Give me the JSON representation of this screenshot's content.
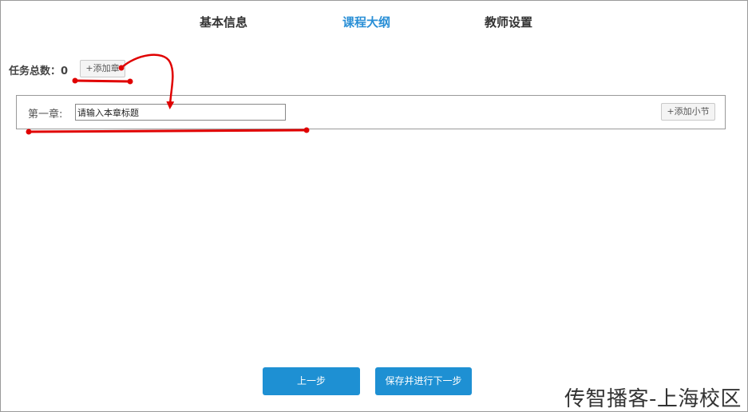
{
  "tabs": [
    {
      "label": "基本信息",
      "active": false
    },
    {
      "label": "课程大纲",
      "active": true
    },
    {
      "label": "教师设置",
      "active": false
    }
  ],
  "toolbar": {
    "total_label": "任务总数：",
    "total_value": "0",
    "add_chapter_label": "+添加章"
  },
  "chapter": {
    "label": "第一章:",
    "title_value": "请输入本章标题",
    "add_section_label": "+添加小节"
  },
  "footer": {
    "prev_label": "上一步",
    "save_next_label": "保存并进行下一步"
  },
  "watermark": "传智播客-上海校区",
  "colors": {
    "accent": "#1e90d3",
    "active_tab": "#2a8fd6",
    "annotation": "#e00000"
  }
}
